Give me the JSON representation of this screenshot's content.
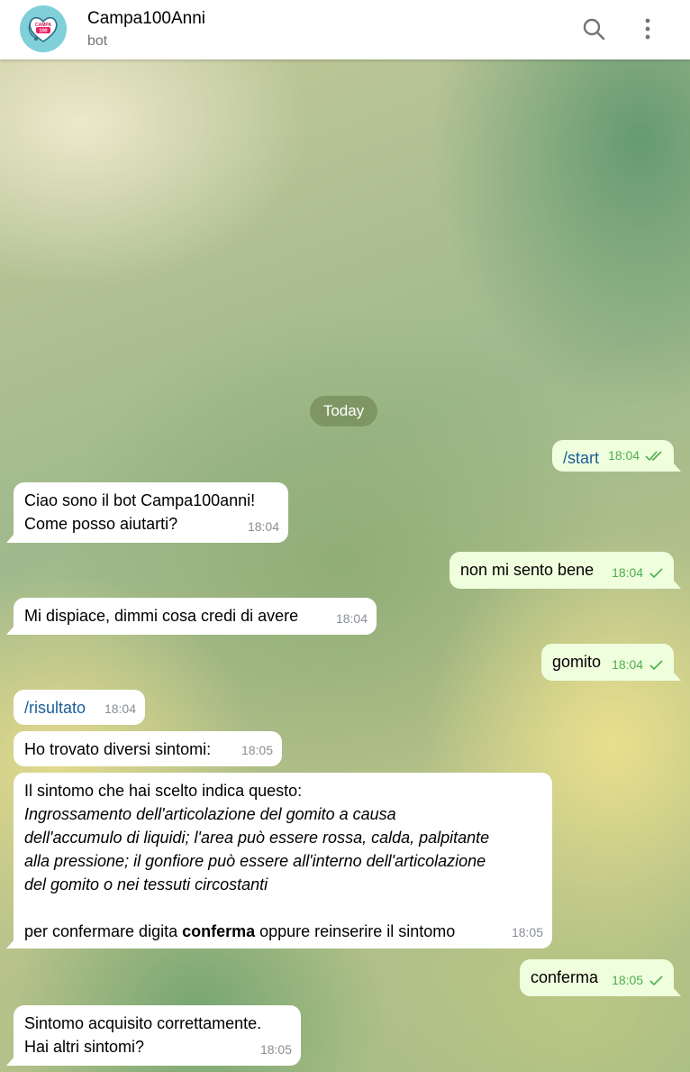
{
  "header": {
    "title": "Campa100Anni",
    "subtitle": "bot",
    "avatar_text_top": "CAMPA",
    "avatar_text_badge": "100",
    "search_icon": "search-icon",
    "menu_icon": "more-vertical-icon"
  },
  "chat": {
    "date_label": "Today",
    "messages": [
      {
        "dir": "out",
        "text": "/start",
        "time": "18:04",
        "status": "read"
      },
      {
        "dir": "in",
        "line1": "Ciao sono il bot Campa100anni!",
        "line2": "Come posso aiutarti?",
        "time": "18:04"
      },
      {
        "dir": "out",
        "text": "non mi sento bene",
        "time": "18:04",
        "status": "sent"
      },
      {
        "dir": "in",
        "text": "Mi dispiace, dimmi cosa credi di avere",
        "time": "18:04"
      },
      {
        "dir": "out",
        "text": "gomito",
        "time": "18:04",
        "status": "sent"
      },
      {
        "dir": "in",
        "text": "/risultato",
        "time": "18:04"
      },
      {
        "dir": "in",
        "text": "Ho trovato diversi sintomi:",
        "time": "18:05"
      },
      {
        "dir": "in",
        "intro": "Il sintomo che hai scelto indica questo:",
        "italic_lines": [
          "Ingrossamento dell'articolazione del gomito a causa",
          "dell'accumulo di liquidi; l'area può essere rossa, calda, palpitante",
          "alla pressione; il gonfiore può essere all'interno dell'articolazione",
          "del gomito o nei tessuti circostanti"
        ],
        "confirm_prefix": "per confermare digita ",
        "confirm_bold": "conferma",
        "confirm_suffix": " oppure reinserire il sintomo",
        "time": "18:05"
      },
      {
        "dir": "out",
        "text": "conferma",
        "time": "18:05",
        "status": "sent"
      },
      {
        "dir": "in",
        "line1": "Sintomo acquisito correttamente.",
        "line2": "Hai altri sintomi?",
        "time": "18:05"
      }
    ]
  },
  "colors": {
    "incoming_bubble": "#ffffff",
    "outgoing_bubble": "#effedd",
    "command_link": "#1c5d98",
    "outgoing_time": "#4fae4e",
    "date_pill": "#768c5a"
  }
}
